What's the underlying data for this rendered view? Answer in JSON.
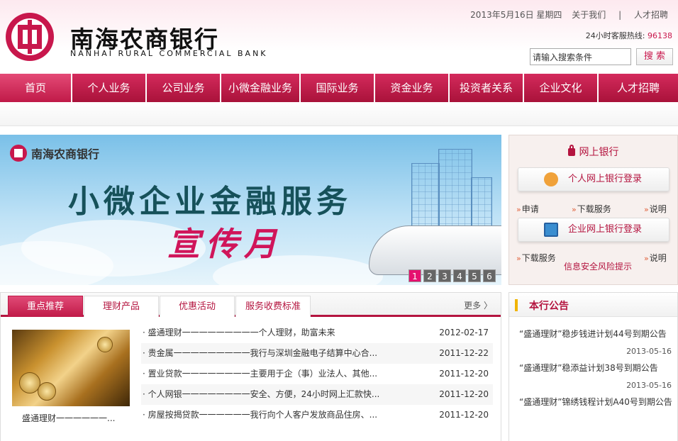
{
  "header": {
    "bank_name_cn": "南海农商银行",
    "bank_name_en": "NANHAI RURAL COMMERCIAL BANK",
    "date": "2013年5月16日 星期四",
    "about": "关于我们",
    "separator": "|",
    "careers": "人才招聘",
    "hotline_label": "24小时客服热线:",
    "hotline_number": "96138",
    "search_value": "请输入搜索条件",
    "search_button": "搜 索"
  },
  "nav": [
    "首页",
    "个人业务",
    "公司业务",
    "小微金融业务",
    "国际业务",
    "资金业务",
    "投资者关系",
    "企业文化",
    "人才招聘"
  ],
  "banner": {
    "logo_text": "南海农商银行",
    "headline": "小微企业金融服务",
    "subline": "宣传月",
    "slides": [
      "1",
      "2",
      "3",
      "4",
      "5",
      "6"
    ],
    "active_slide": "1"
  },
  "ebank": {
    "title": "网上银行",
    "personal_login": "个人网上银行登录",
    "enterprise_login": "企业网上银行登录",
    "link_apply": "申请",
    "link_download_1": "下载服务",
    "link_explain_1": "说明",
    "link_download_2": "下载服务",
    "link_explain_2": "说明",
    "risk_tip": "信息安全风险提示"
  },
  "tabs": {
    "items": [
      "重点推荐",
      "理财产品",
      "优惠活动",
      "服务收费标准"
    ],
    "more": "更多 〉",
    "thumb_caption": "盛通理财一一一一一一...",
    "news": [
      {
        "title": "· 盛通理财一一一一一一一一一个人理财，助富未来",
        "date": "2012-02-17"
      },
      {
        "title": "· 贵金属一一一一一一一一一我行与深圳金融电子结算中心合...",
        "date": "2011-12-22"
      },
      {
        "title": "· 置业贷款一一一一一一一一主要用于企（事）业法人、其他...",
        "date": "2011-12-20"
      },
      {
        "title": "· 个人网银一一一一一一一一安全、方便，24小时网上汇款快...",
        "date": "2011-12-20"
      },
      {
        "title": "· 房屋按揭贷款一一一一一一我行向个人客户发放商品住房、...",
        "date": "2011-12-20"
      }
    ]
  },
  "notice": {
    "title": "本行公告",
    "items": [
      {
        "text": "“盛通理财”稳步钱进计划44号到期公告",
        "date": "2013-05-16"
      },
      {
        "text": "“盛通理财”稳添益计划38号到期公告",
        "date": "2013-05-16"
      },
      {
        "text": "“盛通理财”锦绣钱程计划A40号到期公告",
        "date": ""
      }
    ]
  },
  "colors": {
    "brand": "#b4143f",
    "accent": "#e5106f",
    "notice_accent": "#f0b400"
  }
}
